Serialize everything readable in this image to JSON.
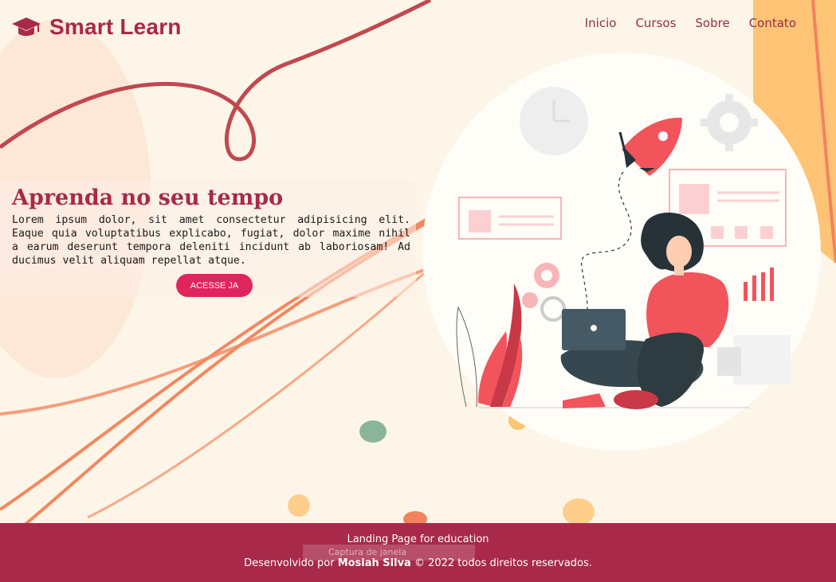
{
  "brand": {
    "name": "Smart Learn",
    "icon": "graduation-cap-icon"
  },
  "nav": {
    "items": [
      "Inicio",
      "Cursos",
      "Sobre",
      "Contato"
    ]
  },
  "hero": {
    "title": "Aprenda no seu tempo",
    "text": "Lorem ipsum dolor, sit amet consectetur adipisicing elit. Eaque quia voluptatibus explicabo, fugiat, dolor maxime nihil a earum deserunt tempora deleniti incidunt ab laboriosam! Ad ducimus velit aliquam repellat atque.",
    "button_label": "ACESSE JA"
  },
  "footer": {
    "line1": "Landing Page for education",
    "line2_prefix": "Desenvolvido por ",
    "author": "Mosiah Silva",
    "line2_suffix": " © 2022 todos direitos reservados.",
    "tooltip": "Captura de janela"
  },
  "colors": {
    "brand": "#a8294a",
    "accent": "#e0245e",
    "background": "#fdf6e8",
    "footer": "#a8294a"
  }
}
